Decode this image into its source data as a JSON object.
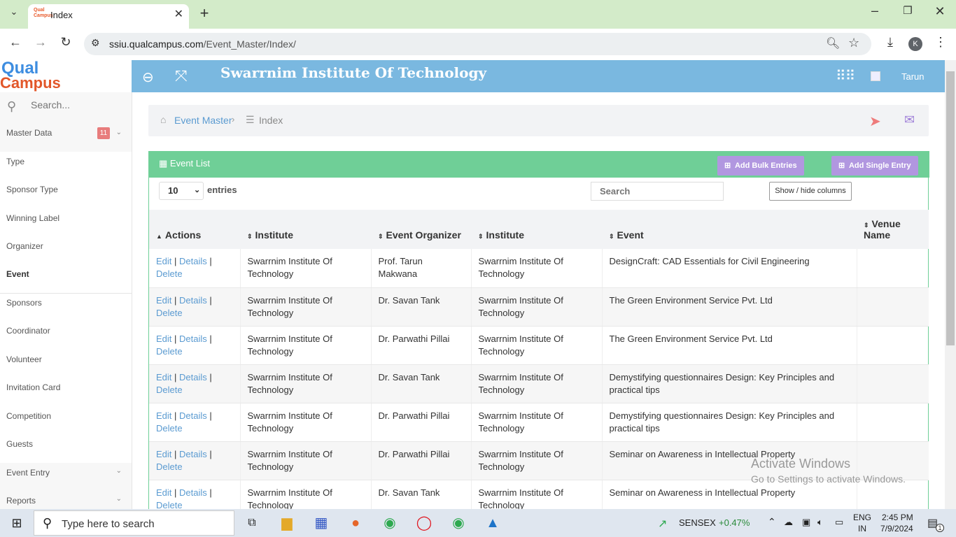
{
  "browser": {
    "tab_title": "Index",
    "favicon_text": "Qual Campus",
    "url_domain": "ssiu.qualcampus.com",
    "url_path": "/Event_Master/Index/",
    "profile_initial": "K"
  },
  "header": {
    "logo_line1": "Qual",
    "logo_line2": "Campus",
    "title": "Swarrnim Institute Of Technology",
    "user_name": "Tarun"
  },
  "sidebar": {
    "search_placeholder": "Search...",
    "master_data": "Master Data",
    "master_badge": "11",
    "items": [
      "Type",
      "Sponsor Type",
      "Winning Label",
      "Organizer",
      "Event",
      "Sponsors",
      "Coordinator",
      "Volunteer",
      "Invitation Card",
      "Competition",
      "Guests"
    ],
    "event_entry": "Event Entry",
    "reports": "Reports"
  },
  "breadcrumb": {
    "item1": "Event Master",
    "item2": "Index"
  },
  "panel": {
    "title": "Event List",
    "add_bulk": "Add Bulk Entries",
    "add_single": "Add Single Entry",
    "page_length": "10",
    "entries_label": "entries",
    "search_placeholder": "Search",
    "show_hide": "Show / hide columns"
  },
  "table": {
    "columns": [
      "Actions",
      "Institute",
      "Event Organizer",
      "Institute",
      "Event",
      "Venue Name"
    ],
    "action_labels": {
      "edit": "Edit",
      "details": "Details",
      "delete": "Delete",
      "sep": "|"
    },
    "rows": [
      {
        "institute": "Swarrnim Institute Of Technology",
        "organizer": "Prof. Tarun Makwana",
        "institute2": "Swarrnim Institute Of Technology",
        "event": "DesignCraft: CAD Essentials for Civil Engineering",
        "venue": ""
      },
      {
        "institute": "Swarrnim Institute Of Technology",
        "organizer": "Dr. Savan Tank",
        "institute2": "Swarrnim Institute Of Technology",
        "event": "The Green Environment Service Pvt. Ltd",
        "venue": ""
      },
      {
        "institute": "Swarrnim Institute Of Technology",
        "organizer": "Dr. Parwathi Pillai",
        "institute2": "Swarrnim Institute Of Technology",
        "event": "The Green Environment Service Pvt. Ltd",
        "venue": ""
      },
      {
        "institute": "Swarrnim Institute Of Technology",
        "organizer": "Dr. Savan Tank",
        "institute2": "Swarrnim Institute Of Technology",
        "event": "Demystifying questionnaires Design: Key Principles and practical tips",
        "venue": ""
      },
      {
        "institute": "Swarrnim Institute Of Technology",
        "organizer": "Dr. Parwathi Pillai",
        "institute2": "Swarrnim Institute Of Technology",
        "event": "Demystifying questionnaires Design: Key Principles and practical tips",
        "venue": ""
      },
      {
        "institute": "Swarrnim Institute Of Technology",
        "organizer": "Dr. Parwathi Pillai",
        "institute2": "Swarrnim Institute Of Technology",
        "event": "Seminar on Awareness in Intellectual Property",
        "venue": ""
      },
      {
        "institute": "Swarrnim Institute Of Technology",
        "organizer": "Dr. Savan Tank",
        "institute2": "Swarrnim Institute Of Technology",
        "event": "Seminar on Awareness in Intellectual Property",
        "venue": ""
      }
    ]
  },
  "watermark": {
    "line1": "Activate Windows",
    "line2": "Go to Settings to activate Windows."
  },
  "taskbar": {
    "search_placeholder": "Type here to search",
    "sensex_label": "SENSEX",
    "sensex_value": "+0.47%",
    "lang1": "ENG",
    "lang2": "IN",
    "time": "2:45 PM",
    "date": "7/9/2024",
    "notif_count": "1"
  }
}
